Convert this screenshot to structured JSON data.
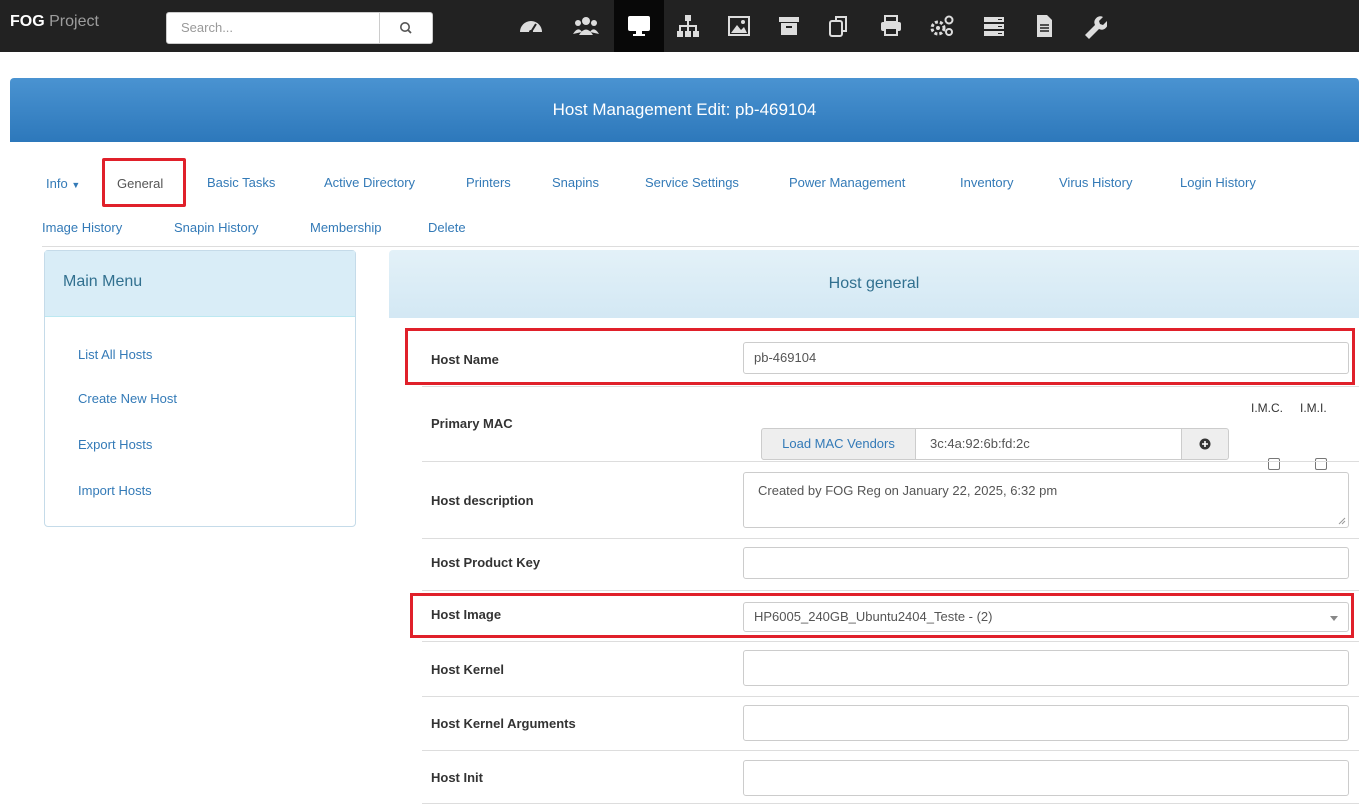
{
  "app": {
    "brand_bold": "FOG",
    "brand_rest": " Project"
  },
  "search": {
    "placeholder": "Search..."
  },
  "nav_icons": [
    "dashboard-icon",
    "users-icon",
    "monitor-icon",
    "sitemap-icon",
    "image-icon",
    "archive-icon",
    "copy-icon",
    "printer-icon",
    "cogs-icon",
    "server-icon",
    "file-icon",
    "wrench-icon"
  ],
  "header": {
    "title": "Host Management Edit: pb-469104"
  },
  "tabs": {
    "info": "Info",
    "general": "General",
    "basic_tasks": "Basic Tasks",
    "active_directory": "Active Directory",
    "printers": "Printers",
    "snapins": "Snapins",
    "service_settings": "Service Settings",
    "power_management": "Power Management",
    "inventory": "Inventory",
    "virus_history": "Virus History",
    "login_history": "Login History",
    "image_history": "Image History",
    "snapin_history": "Snapin History",
    "membership": "Membership",
    "delete": "Delete"
  },
  "sidebar": {
    "title": "Main Menu",
    "items": [
      "List All Hosts",
      "Create New Host",
      "Export Hosts",
      "Import Hosts"
    ]
  },
  "panel": {
    "title": "Host general"
  },
  "fields": {
    "host_name": {
      "label": "Host Name",
      "value": "pb-469104"
    },
    "primary_mac": {
      "label": "Primary MAC",
      "vendor_button": "Load MAC Vendors",
      "value": "3c:4a:92:6b:fd:2c",
      "imc": "I.M.C.",
      "imi": "I.M.I."
    },
    "host_description": {
      "label": "Host description",
      "value": "Created by FOG Reg on January 22, 2025, 6:32 pm"
    },
    "host_product_key": {
      "label": "Host Product Key",
      "value": ""
    },
    "host_image": {
      "label": "Host Image",
      "value": "HP6005_240GB_Ubuntu2404_Teste - (2)"
    },
    "host_kernel": {
      "label": "Host Kernel",
      "value": ""
    },
    "host_kernel_arguments": {
      "label": "Host Kernel Arguments",
      "value": ""
    },
    "host_init": {
      "label": "Host Init",
      "value": ""
    }
  },
  "colors": {
    "navbar": "#222222",
    "header": "#337ab7",
    "link": "#337ab7",
    "highlight": "#e0202a",
    "panel_head": "#d9edf7"
  }
}
